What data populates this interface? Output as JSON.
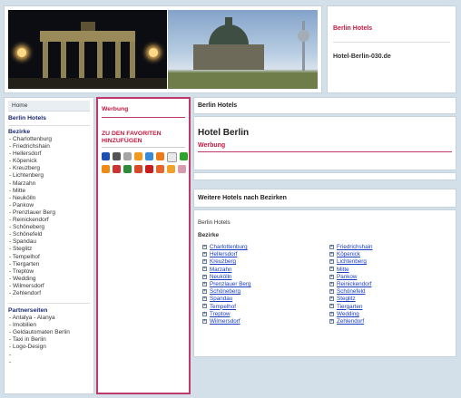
{
  "header": {
    "title": "Berlin Hotels",
    "domain": "Hotel-Berlin-030.de"
  },
  "left_nav": {
    "home": "Home",
    "berlin_hotels": "Berlin Hotels",
    "bezirke_title": "Bezirke",
    "bezirke": [
      "Charlottenburg",
      "Friedrichshain",
      "Hellersdorf",
      "Köpenick",
      "Kreuzberg",
      "Lichtenberg",
      "Marzahn",
      "Mitte",
      "Neukölln",
      "Pankow",
      "Prenzlauer Berg",
      "Reinickendorf",
      "Schöneberg",
      "Schönefeld",
      "Spandau",
      "Steglitz",
      "Tempelhof",
      "Tiergarten",
      "Treptow",
      "Wedding",
      "Wilmersdorf",
      "Zehlendorf"
    ],
    "partner_title": "Partnerseiten",
    "partner": [
      "Antalya - Alanya",
      "Imobilien",
      "Geldautomaten Berlin",
      "Taxi in Berlin",
      "Logo-Design",
      "",
      ""
    ]
  },
  "werbung": {
    "title": "Werbung",
    "favorites": "ZU DEN FAVORITEN HINZUFÜGEN",
    "icons": [
      {
        "name": "delicious-icon",
        "color": "#1d4fb5"
      },
      {
        "name": "digg-icon",
        "color": "#555555"
      },
      {
        "name": "mister-wong-icon",
        "color": "#a5a5a5"
      },
      {
        "name": "yigg-icon",
        "color": "#f29a1e"
      },
      {
        "name": "webnews-icon",
        "color": "#3a8ad8"
      },
      {
        "name": "linkarena-icon",
        "color": "#ef7a1a"
      },
      {
        "name": "bookmark-page-icon",
        "color": "#e9e9e9"
      },
      {
        "name": "folkd-icon",
        "color": "#2ea32e"
      },
      {
        "name": "stumble-icon",
        "color": "#f08a16"
      },
      {
        "name": "oneview-icon",
        "color": "#cc3333"
      },
      {
        "name": "technorati-icon",
        "color": "#2f8a3a"
      },
      {
        "name": "readster-icon",
        "color": "#d94a2a"
      },
      {
        "name": "tausendreporter-icon",
        "color": "#c91c1c"
      },
      {
        "name": "seoigg-icon",
        "color": "#e7652c"
      },
      {
        "name": "newsvine-icon",
        "color": "#f2a12b"
      },
      {
        "name": "linksilo-icon",
        "color": "#d99ab0"
      }
    ]
  },
  "main": {
    "head": "Berlin Hotels",
    "title": "Hotel Berlin",
    "sub": "Werbung"
  },
  "districts": {
    "head": "Weitere Hotels nach Bezirken",
    "hotels_label": "Berlin Hotels",
    "bezirke_label": "Bezirke",
    "col1": [
      "Charlottenburg",
      "Hellersdorf",
      "Kreuzberg",
      "Marzahn",
      "Neukölln",
      "Prenzlauer Berg",
      "Schöneberg",
      "Spandau",
      "Tempelhof",
      "Treptow",
      "Wilmersdorf"
    ],
    "col2": [
      "Friedrichshain",
      "Köpenick",
      "Lichtenberg",
      "Mitte",
      "Pankow",
      "Reinickendorf",
      "Schönefeld",
      "Steglitz",
      "Tiergarten",
      "Wedding",
      "Zehlendorf"
    ]
  }
}
